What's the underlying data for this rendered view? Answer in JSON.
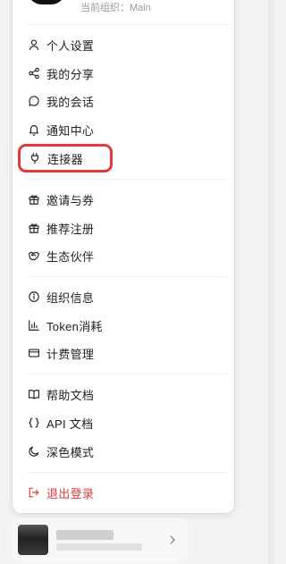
{
  "org": {
    "current_label": "当前组织：Main"
  },
  "menu": {
    "account": [
      {
        "label": "个人设置",
        "icon": "user-icon"
      },
      {
        "label": "我的分享",
        "icon": "share-icon"
      },
      {
        "label": "我的会话",
        "icon": "chat-bubble-icon"
      },
      {
        "label": "通知中心",
        "icon": "bell-icon"
      },
      {
        "label": "连接器",
        "icon": "plug-icon"
      }
    ],
    "growth": [
      {
        "label": "邀请与券",
        "icon": "gift-icon"
      },
      {
        "label": "推荐注册",
        "icon": "gift-icon"
      },
      {
        "label": "生态伙伴",
        "icon": "handshake-icon"
      }
    ],
    "organization": [
      {
        "label": "组织信息",
        "icon": "info-icon"
      },
      {
        "label": "Token消耗",
        "icon": "bar-chart-icon"
      },
      {
        "label": "计费管理",
        "icon": "credit-card-icon"
      }
    ],
    "help": [
      {
        "label": "帮助文档",
        "icon": "book-icon"
      },
      {
        "label": "API 文档",
        "icon": "braces-icon"
      },
      {
        "label": "深色模式",
        "icon": "moon-icon"
      }
    ],
    "logout": {
      "label": "退出登录",
      "icon": "logout-icon"
    }
  },
  "colors": {
    "highlight": "#e53935",
    "danger": "#d63b3b"
  }
}
